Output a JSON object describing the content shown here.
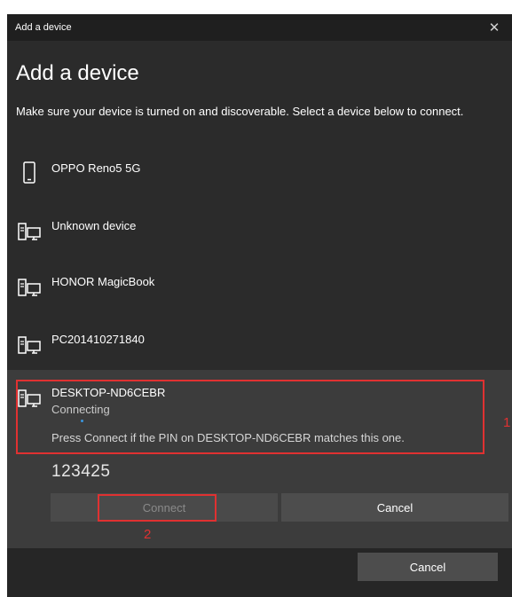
{
  "window": {
    "title": "Add a device",
    "close_glyph": "✕"
  },
  "heading": "Add a device",
  "subtitle": "Make sure your device is turned on and discoverable. Select a device below to connect.",
  "devices": [
    {
      "name": "OPPO Reno5 5G",
      "icon": "phone-icon"
    },
    {
      "name": "Unknown device",
      "icon": "computer-icon"
    },
    {
      "name": "HONOR MagicBook",
      "icon": "computer-icon"
    },
    {
      "name": "PC201410271840",
      "icon": "computer-icon"
    }
  ],
  "selected_device": {
    "name": "DESKTOP-ND6CEBR",
    "status": "Connecting",
    "message": "Press Connect if the PIN on DESKTOP-ND6CEBR matches this one.",
    "pin": "123425",
    "icon": "computer-icon",
    "connect_label": "Connect",
    "cancel_label": "Cancel"
  },
  "footer": {
    "cancel_label": "Cancel"
  },
  "annotations": {
    "label_1": "1",
    "label_2": "2",
    "color": "#e03131"
  },
  "colors": {
    "background": "#2b2b2b",
    "selected_background": "#3c3c3c",
    "titlebar": "#1f1f1f",
    "progress_dot": "#3a96dd"
  }
}
